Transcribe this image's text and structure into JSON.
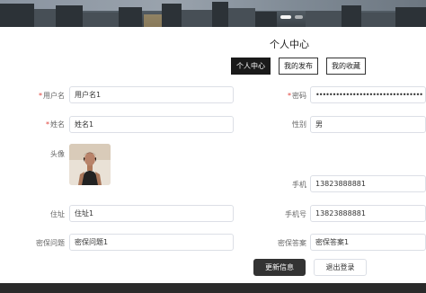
{
  "banner": {
    "icon": "city-skyline-image",
    "slides": 2,
    "active_slide": 1
  },
  "page": {
    "title": "个人中心"
  },
  "tabs": [
    {
      "label": "个人中心",
      "active": true
    },
    {
      "label": "我的发布",
      "active": false
    },
    {
      "label": "我的收藏",
      "active": false
    }
  ],
  "form": {
    "username": {
      "label": "用户名",
      "required": true,
      "value": "用户名1"
    },
    "password": {
      "label": "密码",
      "required": true,
      "value": "••••••••••••••••••••••••••••••••"
    },
    "name": {
      "label": "姓名",
      "required": true,
      "value": "姓名1"
    },
    "gender": {
      "label": "性别",
      "value": "男"
    },
    "avatar": {
      "label": "头像",
      "icon": "user-avatar-photo"
    },
    "phone": {
      "label": "手机",
      "value": "13823888881"
    },
    "address": {
      "label": "住址",
      "value": "住址1"
    },
    "mobile": {
      "label": "手机号",
      "value": "13823888881"
    },
    "security_question": {
      "label": "密保问题",
      "value": "密保问题1"
    },
    "security_answer": {
      "label": "密保答案",
      "value": "密保答案1"
    }
  },
  "actions": {
    "update": "更新信息",
    "logout": "退出登录"
  },
  "colors": {
    "primary": "#333333",
    "required": "#e0413a",
    "border": "#dcdfe6"
  }
}
